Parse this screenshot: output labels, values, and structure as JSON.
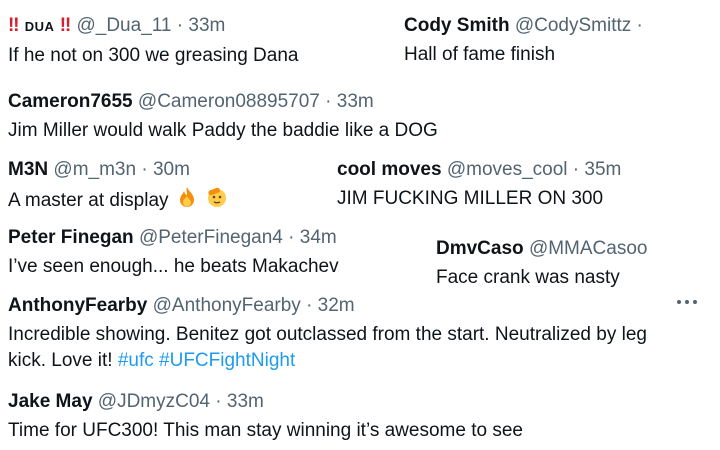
{
  "tweets": [
    {
      "display_name": "DUA",
      "handle": "@_Dua_11",
      "time": "33m",
      "text": "If he not on 300 we greasing Dana"
    },
    {
      "display_name": "Cody Smith",
      "handle": "@CodySmittz",
      "time": "",
      "text": "Hall of fame finish"
    },
    {
      "display_name": "Cameron7655",
      "handle": "@Cameron08895707",
      "time": "33m",
      "text": "Jim Miller would walk Paddy the baddie like a DOG"
    },
    {
      "display_name": "M3N",
      "handle": "@m_m3n",
      "time": "30m",
      "text": "A master at display"
    },
    {
      "display_name": "cool moves",
      "handle": "@moves_cool",
      "time": "35m",
      "text": "JIM FUCKING MILLER ON 300"
    },
    {
      "display_name": "Peter Finegan",
      "handle": "@PeterFinegan4",
      "time": "34m",
      "text": "I’ve seen enough... he beats Makachev"
    },
    {
      "display_name": "DmvCaso",
      "handle": "@MMACasoo",
      "time": "",
      "text": "Face crank was nasty"
    },
    {
      "display_name": "AnthonyFearby",
      "handle": "@AnthonyFearby",
      "time": "32m",
      "text": "Incredible showing. Benitez got outclassed from the start. Neutralized by leg kick. Love it!",
      "hashtags": [
        "#ufc",
        "#UFCFightNight"
      ]
    },
    {
      "display_name": "Jake May",
      "handle": "@JDmyzC04",
      "time": "33m",
      "text": "Time for UFC300! This man stay winning it’s awesome to see"
    }
  ],
  "separator": "·",
  "bang": "‼",
  "icons": {
    "fire": "fire-icon",
    "saluting_face": "saluting-face-icon",
    "more": "more-options-icon"
  },
  "colors": {
    "text": "#0f1419",
    "meta": "#536471",
    "link": "#1d9bf0",
    "alert": "#d8202b"
  }
}
